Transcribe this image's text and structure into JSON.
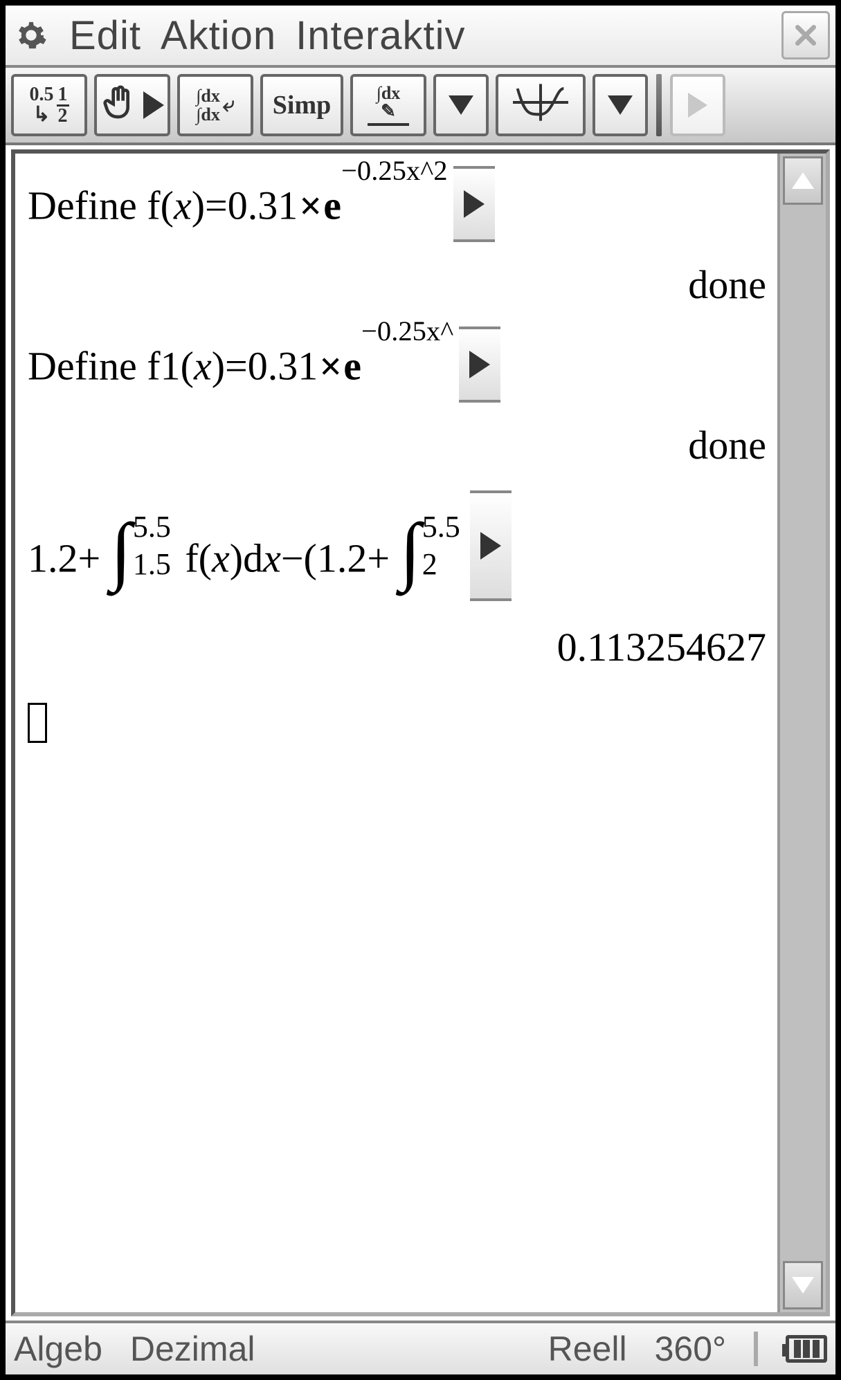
{
  "menubar": {
    "items": [
      "Edit",
      "Aktion",
      "Interaktiv"
    ]
  },
  "toolbar": {
    "btn_frac_top": "0.5",
    "btn_frac_num": "1",
    "btn_frac_den": "2",
    "btn_simp": "Simp",
    "btn_dx_top": "dx",
    "btn_dx_bot": "dx",
    "btn_dx_pencil": "∫dx"
  },
  "lines": {
    "l1_prefix": "Define f(",
    "l1_var": "x",
    "l1_mid": ")=0.31",
    "l1_mult": "×",
    "l1_e": "e",
    "l1_exp": "−0.25x^2",
    "r1": "done",
    "l2_prefix": "Define f1(",
    "l2_var": "x",
    "l2_mid": ")=0.31",
    "l2_mult": "×",
    "l2_e": "e",
    "l2_exp": "−0.25x^",
    "r2": "done",
    "l3_a": "1.2+",
    "l3_int1_hi": "5.5",
    "l3_int1_lo": "1.5",
    "l3_b": "f(",
    "l3_b_var": "x",
    "l3_c": ")d",
    "l3_c_var": "x",
    "l3_d": "−(1.2+",
    "l3_int2_hi": "5.5",
    "l3_int2_lo": "2",
    "r3": "0.113254627"
  },
  "status": {
    "mode": "Algeb",
    "num": "Dezimal",
    "real": "Reell",
    "angle": "360°"
  }
}
